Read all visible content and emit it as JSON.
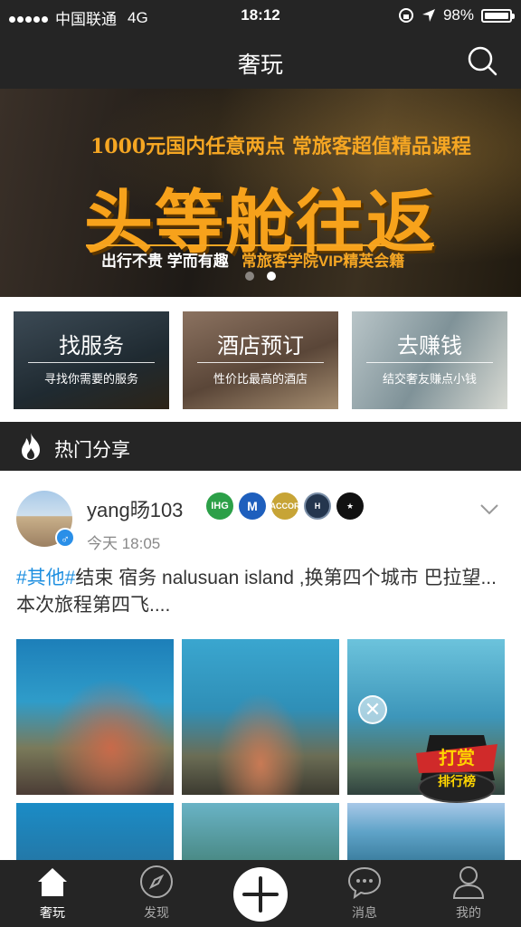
{
  "status": {
    "carrier": "中国联通",
    "network": "4G",
    "time": "18:12",
    "battery": "98%"
  },
  "navbar": {
    "title": "奢玩"
  },
  "banner": {
    "tagline": "1000元国内任意两点  常旅客超值精品课程",
    "headline": "头等舱往返",
    "sub_left": "出行不贵  学而有趣",
    "sub_right": "常旅客学院VIP精英会籍",
    "page_count": 2,
    "active_page": 2
  },
  "categories": [
    {
      "title": "找服务",
      "subtitle": "寻找你需要的服务"
    },
    {
      "title": "酒店预订",
      "subtitle": "性价比最高的酒店"
    },
    {
      "title": "去赚钱",
      "subtitle": "结交奢友赚点小钱"
    }
  ],
  "section": {
    "title": "热门分享"
  },
  "post": {
    "username": "yang旸103",
    "time": "今天 18:05",
    "badges": [
      "IHG",
      "M",
      "ACCOR",
      "H",
      "★"
    ],
    "hashtags": "#其他#",
    "text": "结束 宿务 nalusuan island ,换第四个城市 巴拉望...本次旅程第四飞...."
  },
  "reward": {
    "label1": "打赏",
    "label2": "排行榜"
  },
  "tabbar": [
    {
      "label": "奢玩",
      "icon": "home-icon",
      "active": true
    },
    {
      "label": "发现",
      "icon": "compass-icon",
      "active": false
    },
    {
      "label": "",
      "icon": "plus-icon",
      "active": false
    },
    {
      "label": "消息",
      "icon": "message-icon",
      "active": false
    },
    {
      "label": "我的",
      "icon": "user-icon",
      "active": false
    }
  ],
  "colors": {
    "dark": "#252525",
    "accent": "#f7a21b",
    "hashtag": "#1e8fe0"
  }
}
